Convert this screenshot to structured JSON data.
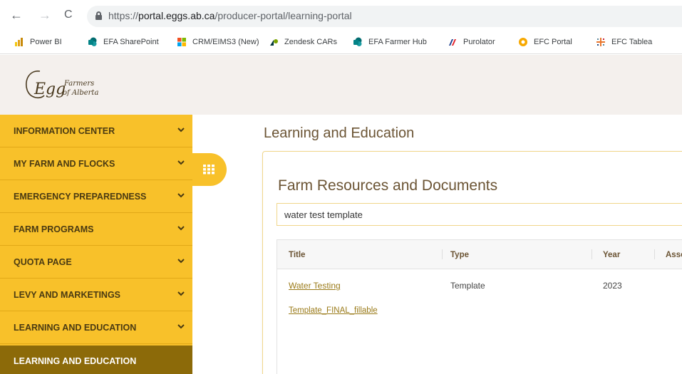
{
  "browser": {
    "url_prefix": "https://",
    "url_domain": "portal.eggs.ab.ca",
    "url_path": "/producer-portal/learning-portal",
    "nav": {
      "back": "←",
      "forward": "→",
      "reload": "C"
    },
    "bookmarks": [
      {
        "label": "Power BI",
        "icon": "power-bi-icon",
        "color": "#f2c811"
      },
      {
        "label": "EFA SharePoint",
        "icon": "sharepoint-icon",
        "color": "#038387"
      },
      {
        "label": "CRM/EIMS3 (New)",
        "icon": "microsoft-icon",
        "color": "#f25022"
      },
      {
        "label": "Zendesk CARs",
        "icon": "zendesk-icon",
        "color": "#03363d"
      },
      {
        "label": "EFA Farmer Hub",
        "icon": "sharepoint-icon",
        "color": "#038387"
      },
      {
        "label": "Purolator",
        "icon": "purolator-icon",
        "color": "#1a3c8e"
      },
      {
        "label": "EFC Portal",
        "icon": "efc-portal-icon",
        "color": "#f7a800"
      },
      {
        "label": "EFC Tablea",
        "icon": "tableau-icon",
        "color": "#e8762d"
      }
    ]
  },
  "logo": {
    "text_main": "Egg",
    "text_line1": "Farmers",
    "text_line2": "of Alberta"
  },
  "sidebar": {
    "items": [
      {
        "label": "INFORMATION CENTER"
      },
      {
        "label": "MY FARM AND FLOCKS"
      },
      {
        "label": "EMERGENCY PREPAREDNESS"
      },
      {
        "label": "FARM PROGRAMS"
      },
      {
        "label": "QUOTA PAGE"
      },
      {
        "label": "LEVY AND MARKETINGS"
      },
      {
        "label": "LEARNING AND EDUCATION"
      }
    ],
    "active_label": "LEARNING AND EDUCATION"
  },
  "main": {
    "page_title": "Learning and Education",
    "card_title": "Farm Resources and Documents",
    "search_value": "water test template",
    "table": {
      "headers": [
        "Title",
        "Type",
        "Year",
        "Asso"
      ],
      "rows": [
        {
          "title": "Water Testing",
          "type": "Template",
          "year": "2023"
        },
        {
          "title": "Template_FINAL_fillable",
          "type": "",
          "year": ""
        }
      ]
    }
  },
  "colors": {
    "sidebar_bg": "#f8c12a",
    "sidebar_active": "#8c6a09",
    "header_bg": "#f4f0ed",
    "title_brown": "#6b5434",
    "link_gold": "#9a7a18"
  }
}
